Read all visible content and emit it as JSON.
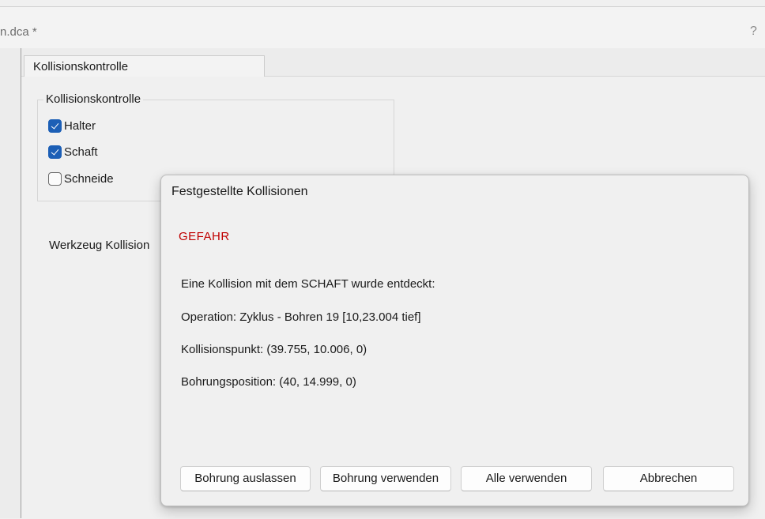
{
  "window": {
    "title": "n.dca *",
    "help_label": "?"
  },
  "tab": {
    "label": "Kollisionskontrolle"
  },
  "group": {
    "legend": "Kollisionskontrolle",
    "checkboxes": [
      {
        "label": "Halter",
        "checked": true
      },
      {
        "label": "Schaft",
        "checked": true
      },
      {
        "label": "Schneide",
        "checked": false
      }
    ]
  },
  "werkzeug_label": "Werkzeug Kollision",
  "dialog": {
    "title": "Festgestellte Kollisionen",
    "danger": "GEFAHR",
    "messages": [
      "Eine Kollision mit dem SCHAFT wurde entdeckt:",
      "Operation: Zyklus - Bohren 19 [10,23.004 tief]",
      "Kollisionspunkt: (39.755, 10.006, 0)",
      "Bohrungsposition: (40, 14.999, 0)"
    ],
    "buttons": {
      "skip": "Bohrung auslassen",
      "use": "Bohrung verwenden",
      "use_all": "Alle verwenden",
      "cancel": "Abbrechen"
    }
  },
  "colors": {
    "accent": "#1c5fb6",
    "danger": "#c00000"
  }
}
